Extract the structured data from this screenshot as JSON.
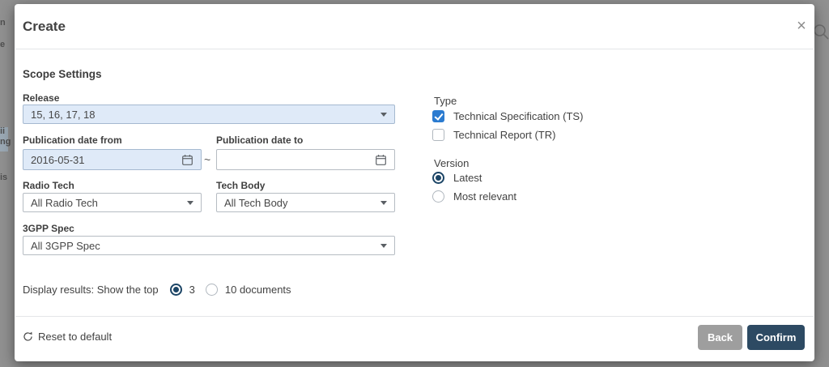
{
  "dialog": {
    "title": "Create",
    "section_title": "Scope Settings",
    "release": {
      "label": "Release",
      "value": "15, 16, 17, 18"
    },
    "pub_date_from": {
      "label": "Publication date from",
      "value": "2016-05-31"
    },
    "pub_date_to": {
      "label": "Publication date to",
      "value": ""
    },
    "date_separator": "~",
    "radio_tech": {
      "label": "Radio Tech",
      "value": "All Radio Tech"
    },
    "tech_body": {
      "label": "Tech Body",
      "value": "All Tech Body"
    },
    "gpp_spec": {
      "label": "3GPP Spec",
      "value": "All 3GPP Spec"
    },
    "display_results": {
      "label": "Display results: Show the top",
      "options": [
        {
          "label": "3",
          "selected": true
        },
        {
          "label": "10 documents",
          "selected": false
        }
      ]
    },
    "type_group": {
      "label": "Type",
      "options": [
        {
          "label": "Technical Specification (TS)",
          "checked": true
        },
        {
          "label": "Technical Report (TR)",
          "checked": false
        }
      ]
    },
    "version_group": {
      "label": "Version",
      "options": [
        {
          "label": "Latest",
          "selected": true
        },
        {
          "label": "Most relevant",
          "selected": false
        }
      ]
    },
    "footer": {
      "reset_label": "Reset to default",
      "back_label": "Back",
      "confirm_label": "Confirm"
    },
    "icons": {
      "close": "×"
    }
  },
  "background": {
    "fragments": [
      "n",
      "e",
      "ii",
      "ng",
      "is"
    ]
  },
  "colors": {
    "overlay": "#909090",
    "accent_checkbox": "#2b7bd0",
    "radio_selected": "#1c4566",
    "confirm_bg": "#2d4a63",
    "back_bg": "#9e9e9e",
    "filled_field_bg": "#dfeaf8",
    "filled_field_border": "#a5b9d0"
  }
}
